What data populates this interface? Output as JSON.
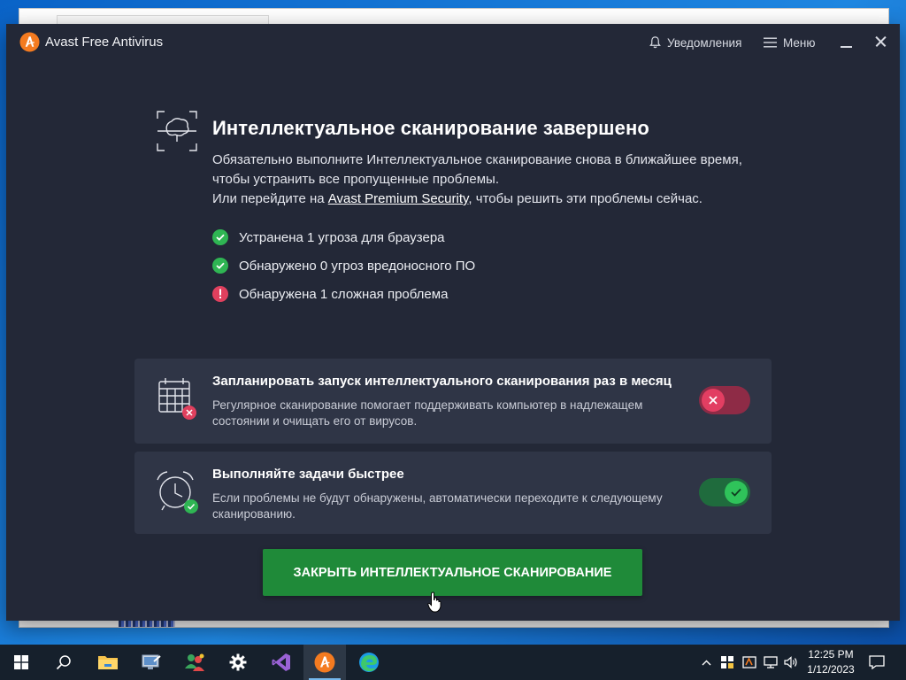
{
  "app": {
    "title": "Avast Free Antivirus",
    "notifications_label": "Уведомления",
    "menu_label": "Меню"
  },
  "scan": {
    "heading": "Интеллектуальное сканирование завершено",
    "desc_line1": "Обязательно выполните Интеллектуальное сканирование снова в ближайшее время, чтобы устранить все пропущенные проблемы.",
    "desc_line2_prefix": "Или перейдите на ",
    "desc_link": "Avast Premium Security",
    "desc_line2_suffix": ", чтобы решить эти проблемы сейчас.",
    "results": [
      {
        "status": "ok",
        "text": "Устранена 1 угроза для браузера"
      },
      {
        "status": "ok",
        "text": "Обнаружено 0 угроз вредоносного ПО"
      },
      {
        "status": "issue",
        "text": "Обнаружена 1 сложная проблема"
      }
    ]
  },
  "options": [
    {
      "title": "Запланировать запуск интеллектуального сканирования раз в месяц",
      "text": "Регулярное сканирование помогает поддерживать компьютер в надлежащем состоянии и очищать его от вирусов.",
      "enabled": false,
      "icon": "calendar-icon"
    },
    {
      "title": "Выполняйте задачи быстрее",
      "text": "Если проблемы не будут обнаружены, автоматически переходите к следующему сканированию.",
      "enabled": true,
      "icon": "alarm-clock-icon"
    }
  ],
  "close_button_label": "ЗАКРЫТЬ ИНТЕЛЛЕКТУАЛЬНОЕ СКАНИРОВАНИЕ",
  "taskbar": {
    "apps": [
      "windows-start",
      "search",
      "file-explorer",
      "remote-desktop",
      "people-app",
      "settings",
      "visual-studio",
      "avast",
      "edge"
    ],
    "active_app": "avast",
    "time": "12:25 PM",
    "date": "1/12/2023"
  },
  "colors": {
    "app_bg": "#232837",
    "card_bg": "#2f3546",
    "ok_green": "#2fb553",
    "issue_red": "#e0405e",
    "cta_green": "#1f8a39",
    "avast_orange": "#f47b20"
  }
}
